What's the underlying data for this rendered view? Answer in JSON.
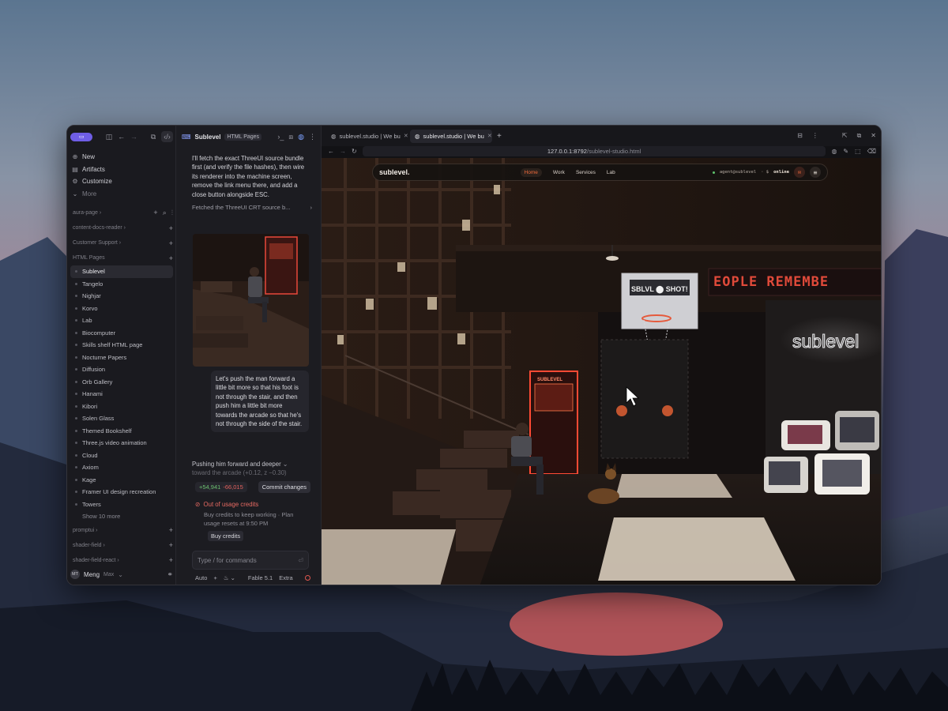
{
  "sidebar": {
    "actions": [
      {
        "icon": "plus-icon",
        "label": "New"
      },
      {
        "icon": "artifacts-icon",
        "label": "Artifacts"
      },
      {
        "icon": "customize-icon",
        "label": "Customize"
      },
      {
        "icon": "chevron-down-icon",
        "label": "More"
      }
    ],
    "sections": {
      "aura_page": "aura-page",
      "content_docs_reader": "content-docs-reader",
      "customer_support": "Customer Support",
      "html_pages": "HTML Pages",
      "promptui": "promptui",
      "shader_field": "shader-field",
      "shader_field_react": "shader-field-react"
    },
    "projects": [
      "Sublevel",
      "Tangelo",
      "Nighjar",
      "Korvo",
      "Lab",
      "Biocomputer",
      "Skills shelf HTML page",
      "Nocturne Papers",
      "Diffusion",
      "Orb Gallery",
      "Hanami",
      "Kibori",
      "Solen Glass",
      "Themed Bookshelf",
      "Three.js video animation",
      "Cloud",
      "Axiom",
      "Kage",
      "Framer UI design recreation",
      "Towers"
    ],
    "show_more": "Show 10 more",
    "user": {
      "initials": "MT",
      "name": "Meng",
      "plan": "Max"
    }
  },
  "chat": {
    "title": "Sublevel",
    "badge": "HTML Pages",
    "ai_message": "I'll fetch the exact ThreeUI source bundle first (and verify the file hashes), then wire its renderer into the machine screen, remove the link menu there, and add a close button alongside ESC.",
    "tool_call": "Fetched the ThreeUI CRT source b...",
    "user_message": "Let's push the man forward a little bit more so that his foot is not through the stair, and then push him a little bit more towards the arcade so that he's not through the side of the stair.",
    "ai_message_2": "Pushing him forward and deeper",
    "ai_message_2_fade": "toward the arcade (+0.12, z −0.30)",
    "diff_plus": "+54,941",
    "diff_minus": "-66,015",
    "commit_label": "Commit changes",
    "credits_title": "Out of usage credits",
    "credits_desc": "Buy credits to keep working · Plan usage resets at 9:50 PM",
    "buy_label": "Buy credits",
    "composer_placeholder": "Type / for commands",
    "mode": "Auto",
    "model": "Fable 5.1",
    "effort": "Extra"
  },
  "browser": {
    "tabs": [
      {
        "title": "sublevel.studio | We bu"
      },
      {
        "title": "sublevel.studio | We bu"
      }
    ],
    "url_host": "127.0.0.1:8792",
    "url_path": "/sublevel-studio.html"
  },
  "site": {
    "brand": "sublevel.",
    "nav": [
      "Home",
      "Work",
      "Services",
      "Lab"
    ],
    "status_user": "agent@sublevel",
    "status_sep": "· $",
    "status_online": "online",
    "hoop_sign": "SBLVL ⬤ SHOT!",
    "ticker": "EOPLE REMEMBE",
    "neon": "sublevel",
    "arcade_label": "SUBLEVEL"
  },
  "colors": {
    "accent": "#f06a3b",
    "purple": "#6f5ee6",
    "danger": "#e0605c",
    "success": "#6cc070"
  }
}
